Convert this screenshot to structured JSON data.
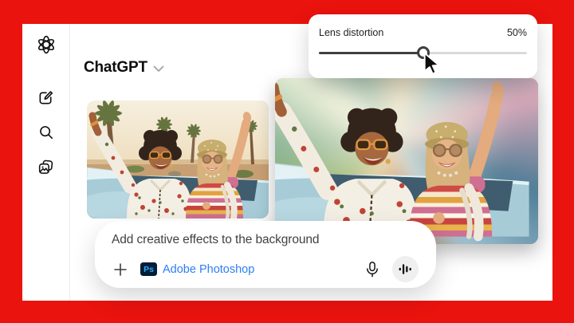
{
  "header": {
    "title": "ChatGPT"
  },
  "sidebar": {
    "items": [
      {
        "name": "openai-logo"
      },
      {
        "name": "new-chat"
      },
      {
        "name": "search"
      },
      {
        "name": "library"
      }
    ]
  },
  "slider": {
    "label": "Lens distortion",
    "value": "50%",
    "percent": 50
  },
  "images": {
    "left_alt": "Two friends riding in a convertible through the desert",
    "right_alt": "Edited photo with radial lens-distortion blur on the background"
  },
  "composer": {
    "prompt": "Add creative effects to the background",
    "app_badge": "Ps",
    "app_name": "Adobe Photoshop"
  },
  "colors": {
    "frame-red": "#EA130E",
    "adobe-blue": "#2D7DF6",
    "ps-badge-bg": "#001E36",
    "ps-badge-text": "#31A8FF",
    "slider-fill": "#3F3F3F",
    "slider-track": "#DADADA",
    "text-primary": "#0D0D0D"
  }
}
